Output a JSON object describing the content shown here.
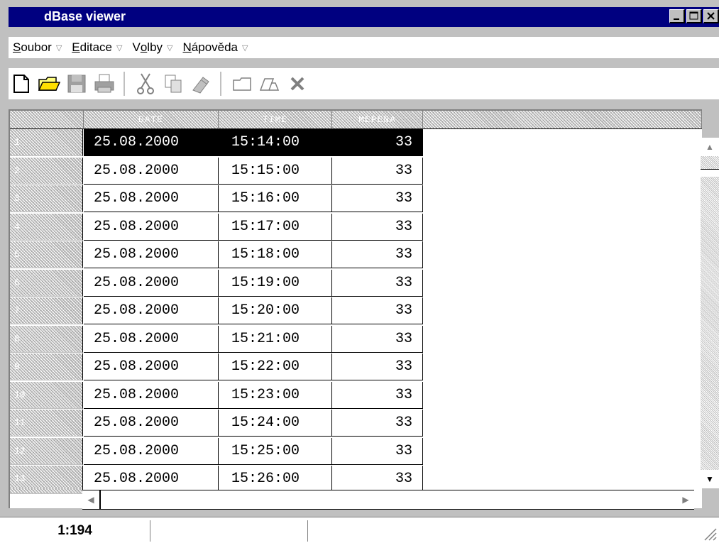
{
  "window": {
    "title": "dBase viewer"
  },
  "menu": {
    "items": [
      {
        "pre": "",
        "u": "S",
        "post": "oubor"
      },
      {
        "pre": "",
        "u": "E",
        "post": "ditace"
      },
      {
        "pre": "V",
        "u": "o",
        "post": "lby"
      },
      {
        "pre": "",
        "u": "N",
        "post": "ápověda"
      }
    ]
  },
  "toolbar": {
    "icons": [
      "new-file-icon",
      "open-folder-icon",
      "save-icon",
      "print-icon",
      "cut-icon",
      "copy-icon",
      "paste-icon",
      "new-record-icon",
      "edit-record-icon",
      "delete-icon"
    ]
  },
  "grid": {
    "columns": [
      "DATE",
      "TIME",
      "MEPENA"
    ],
    "rows": [
      {
        "num": "1",
        "date": "25.08.2000",
        "time": "15:14:00",
        "value": "33"
      },
      {
        "num": "2",
        "date": "25.08.2000",
        "time": "15:15:00",
        "value": "33"
      },
      {
        "num": "3",
        "date": "25.08.2000",
        "time": "15:16:00",
        "value": "33"
      },
      {
        "num": "4",
        "date": "25.08.2000",
        "time": "15:17:00",
        "value": "33"
      },
      {
        "num": "5",
        "date": "25.08.2000",
        "time": "15:18:00",
        "value": "33"
      },
      {
        "num": "6",
        "date": "25.08.2000",
        "time": "15:19:00",
        "value": "33"
      },
      {
        "num": "7",
        "date": "25.08.2000",
        "time": "15:20:00",
        "value": "33"
      },
      {
        "num": "8",
        "date": "25.08.2000",
        "time": "15:21:00",
        "value": "33"
      },
      {
        "num": "9",
        "date": "25.08.2000",
        "time": "15:22:00",
        "value": "33"
      },
      {
        "num": "10",
        "date": "25.08.2000",
        "time": "15:23:00",
        "value": "33"
      },
      {
        "num": "11",
        "date": "25.08.2000",
        "time": "15:24:00",
        "value": "33"
      },
      {
        "num": "12",
        "date": "25.08.2000",
        "time": "15:25:00",
        "value": "33"
      },
      {
        "num": "13",
        "date": "25.08.2000",
        "time": "15:26:00",
        "value": "33"
      }
    ],
    "selected_row": 0
  },
  "status": {
    "position": "1:194"
  }
}
